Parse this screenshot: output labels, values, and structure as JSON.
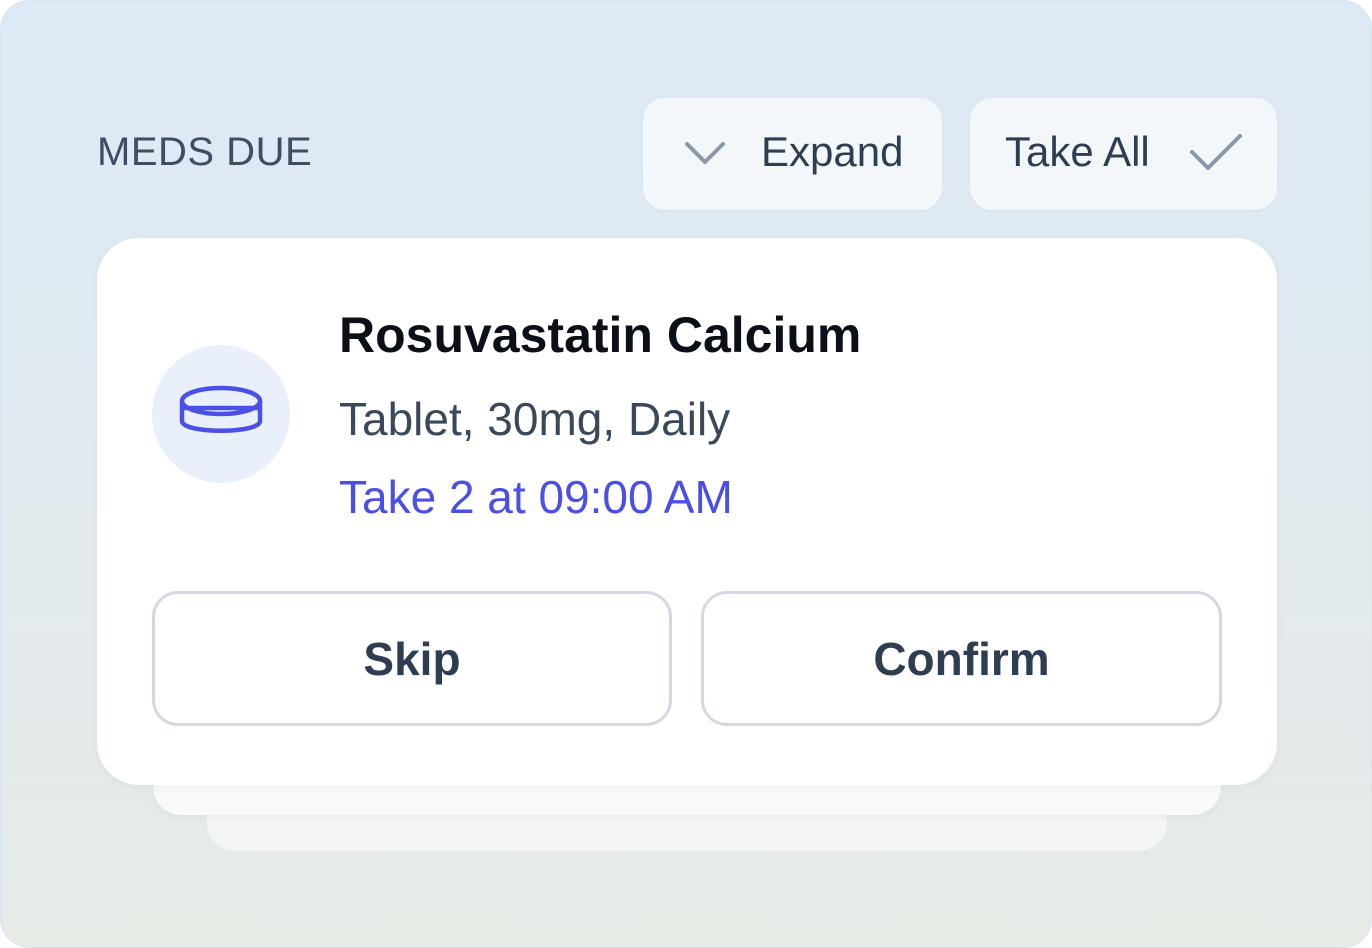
{
  "header": {
    "title": "MEDS DUE",
    "expand": {
      "label": "Expand",
      "icon": "chevron-down-icon"
    },
    "take_all": {
      "label": "Take All",
      "icon": "checkmark-icon"
    }
  },
  "medication": {
    "icon": "pill-tablet-icon",
    "name": "Rosuvastatin Calcium",
    "detail": "Tablet, 30mg, Daily",
    "schedule": "Take 2 at 09:00 AM",
    "actions": {
      "skip_label": "Skip",
      "confirm_label": "Confirm"
    }
  },
  "colors": {
    "accent": "#4a4fe6",
    "text_primary": "#0b0f17",
    "text_secondary": "#3b475b",
    "icon_bg": "#e9f0fc",
    "icon_muted": "#8c97a8"
  }
}
